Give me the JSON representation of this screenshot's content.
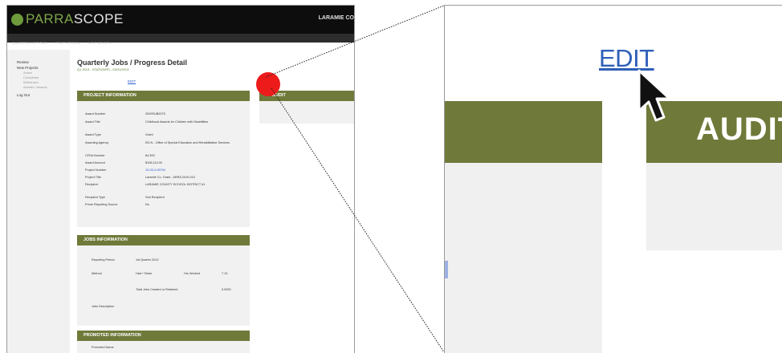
{
  "app": {
    "logo_part1": "",
    "logo_part2": "PARRA",
    "logo_part3": "SCOPE",
    "client_name": "LARAMIE CO",
    "nav_items": [
      "QUARTERLY OPTIONS",
      "PRINT VERSION",
      "HELP SEARCH"
    ]
  },
  "sidebar": {
    "items": [
      "Review",
      "New Projects",
      "Log Out"
    ],
    "subitems": [
      "Active",
      "Completed",
      "Withdrawn",
      "Awards / Awards"
    ]
  },
  "page": {
    "title": "Quarterly Jobs / Progress Detail",
    "subtitle": "Q1 2013 - STATUS/RS - 03/31/2013",
    "edit_link": "EDIT"
  },
  "project_info": {
    "heading": "PROJECT INFORMATION",
    "rows": [
      {
        "label": "Award Number",
        "value": "2009SUB0075"
      },
      {
        "label": "Award Title",
        "value": "Childhood Awards for Children with Disabilities"
      },
      {
        "label": "Award Type",
        "value": "Grant"
      },
      {
        "label": "Awarding Agency",
        "value": "ED-N - Office of Special Education and Rehabilitative Services"
      },
      {
        "label": "CFDA Number",
        "value": "84.393"
      },
      {
        "label": "Award Amount",
        "value": "$108,114.00"
      },
      {
        "label": "Project Number",
        "value": "10-05-4-06794"
      },
      {
        "label": "Project Title",
        "value": "Laramie Co. Grant - ARRA 2010-010"
      },
      {
        "label": "Recipient",
        "value": "LARAMIE COUNTY SCHOOL DISTRICT #1"
      },
      {
        "label": "Recipient Type",
        "value": "Sub Recipient"
      },
      {
        "label": "Prime Reporting Source",
        "value": "No"
      }
    ]
  },
  "jobs_info": {
    "heading": "JOBS INFORMATION",
    "rows": [
      {
        "label": "Reporting Period",
        "value": "1st Quarter 2013"
      },
      {
        "label": "Method",
        "value": "Hart / Share"
      },
      {
        "label": "Jobs Description",
        "value": ""
      }
    ],
    "hrs_worked_label": "Hrs Worked",
    "hrs_worked_value": "7.13",
    "total_jobs_label": "Total Jobs Created or Retained",
    "total_jobs_value": "0.0000"
  },
  "promoted_info": {
    "heading": "PROMOTED INFORMATION",
    "row_label": "Promoted Name"
  },
  "audit": {
    "heading": "AUDIT"
  },
  "zoom": {
    "edit_link": "EDIT",
    "audit_heading": "AUDIT"
  },
  "colors": {
    "panel_header": "#6f7a3a",
    "link": "#2f5fb8",
    "highlight": "#ee1b1b",
    "topbar": "#0d0d0d"
  }
}
